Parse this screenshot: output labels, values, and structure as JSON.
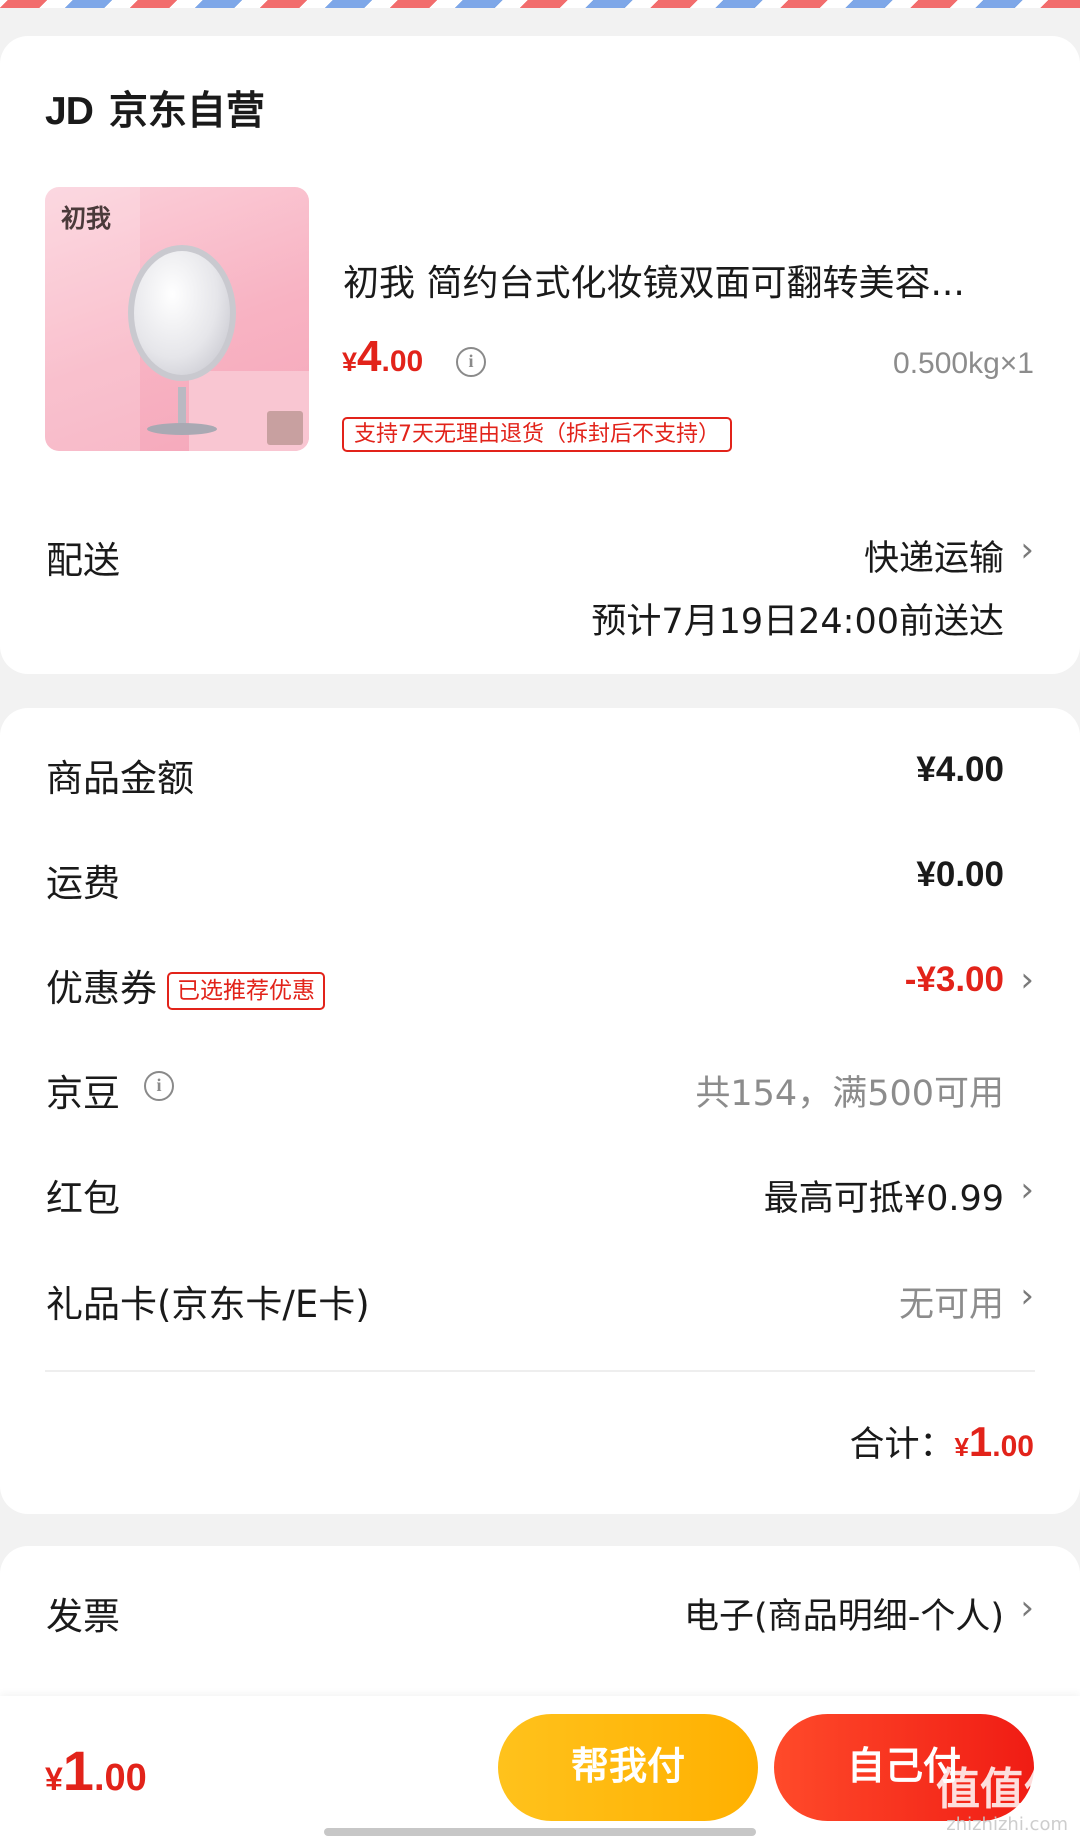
{
  "store": {
    "logo": "JD",
    "name": "京东自营"
  },
  "product": {
    "image_brand": "初我",
    "title": "初我 简约台式化妆镜双面可翻转美容...",
    "price_currency": "¥",
    "price_int": "4",
    "price_dec": ".00",
    "weight_qty": "0.500kg×1",
    "return_tag": "支持7天无理由退货（拆封后不支持）"
  },
  "delivery": {
    "label": "配送",
    "method": "快递运输",
    "estimate": "预计7月19日24:00前送达"
  },
  "summary": {
    "goods_label": "商品金额",
    "goods_value": "¥4.00",
    "shipping_label": "运费",
    "shipping_value": "¥0.00",
    "coupon_label": "优惠券",
    "coupon_badge": "已选推荐优惠",
    "coupon_value": "-¥3.00",
    "jingdou_label": "京豆",
    "jingdou_value": "共154，满500可用",
    "redpacket_label": "红包",
    "redpacket_value": "最高可抵¥0.99",
    "giftcard_label": "礼品卡(京东卡/E卡)",
    "giftcard_value": "无可用",
    "total_label": "合计：",
    "total_currency": "¥",
    "total_int": "1",
    "total_dec": ".00"
  },
  "invoice": {
    "label": "发票",
    "value": "电子(商品明细-个人)"
  },
  "bottom": {
    "price_currency": "¥",
    "price_int": "1",
    "price_dec": ".00",
    "help_pay": "帮我付",
    "self_pay": "自己付",
    "watermark": "值值值",
    "watermark_sub": "zhizhizhi.com"
  },
  "icons": {
    "info": "info-icon",
    "chevron": "chevron-right-icon"
  },
  "colors": {
    "accent": "#e2231a",
    "help_button": "#ffc21c",
    "self_button": "#f01c14"
  }
}
